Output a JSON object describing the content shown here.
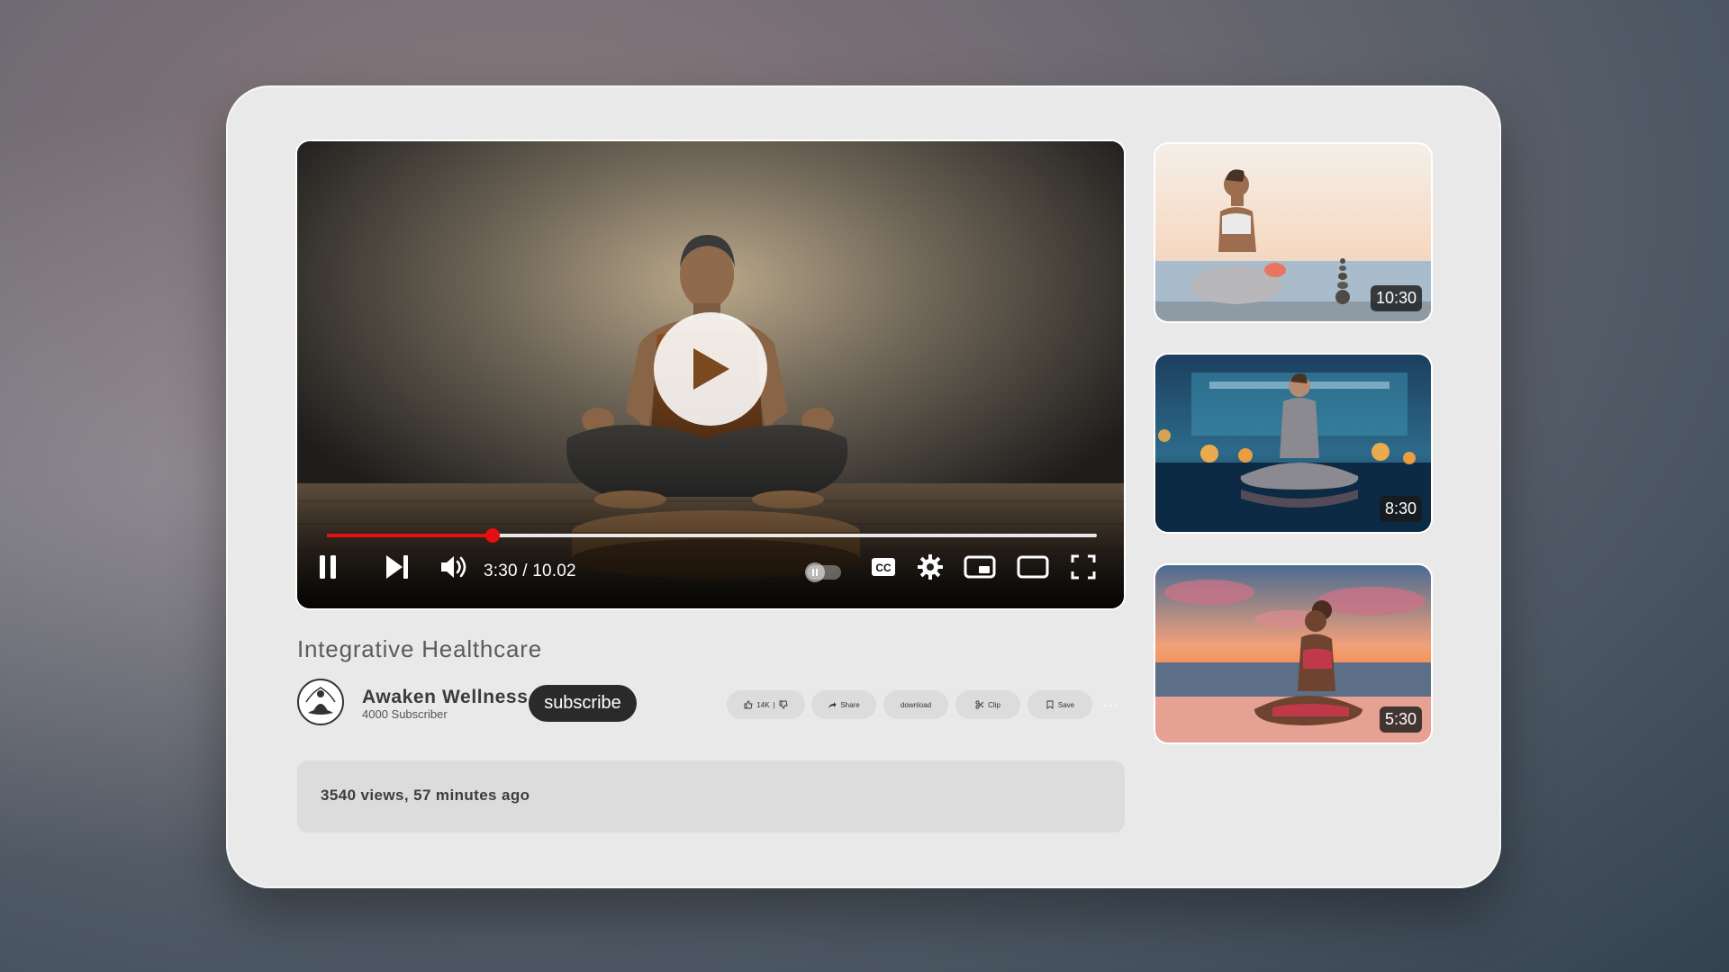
{
  "player": {
    "time_display": "3:30 / 10.02",
    "progress": 0.215,
    "accent": "#e61010"
  },
  "video": {
    "title": "Integrative Healthcare"
  },
  "channel": {
    "name": "Awaken Wellness",
    "subscribers": "4000 Subscriber",
    "subscribe_label": "subscribe"
  },
  "actions": {
    "like_count": "14K",
    "share_label": "Share",
    "download_label": "download",
    "clip_label": "Clip",
    "save_label": "Save",
    "more": "..."
  },
  "description": {
    "meta": "3540 views, 57 minutes ago"
  },
  "sidebar": {
    "items": [
      {
        "duration": "10:30",
        "scene": "beach-day-meditation"
      },
      {
        "duration": "8:30",
        "scene": "pool-night-meditation"
      },
      {
        "duration": "5:30",
        "scene": "sunset-beach-meditation"
      }
    ]
  }
}
